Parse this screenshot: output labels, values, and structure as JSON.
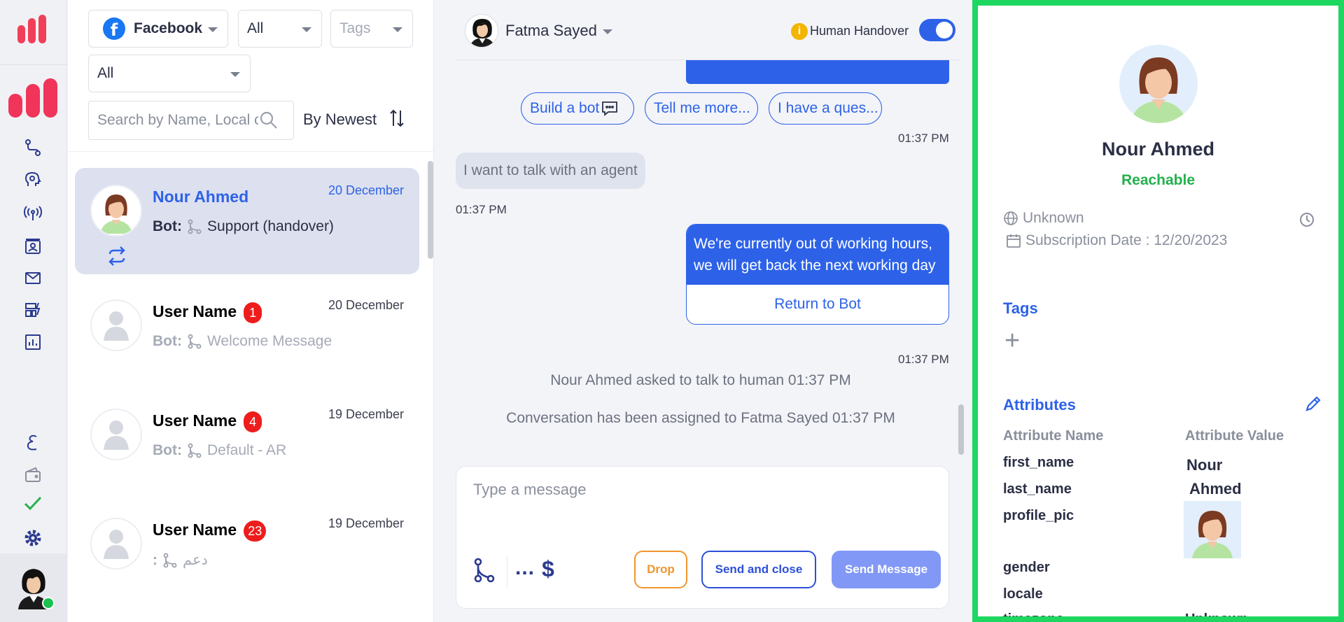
{
  "filters": {
    "channel": "Facebook",
    "channel_icon_letter": "f",
    "status": "All",
    "tags_placeholder": "Tags",
    "assignee": "All",
    "search_placeholder": "Search by Name, Local c",
    "sort_label": "By Newest"
  },
  "conversations": [
    {
      "name": "Nour Ahmed",
      "date": "20 December",
      "bot_label": "Bot:",
      "flow": "Support (handover)",
      "badge": ""
    },
    {
      "name": "User Name",
      "date": "20 December",
      "bot_label": "Bot:",
      "flow": "Welcome Message",
      "badge": "1"
    },
    {
      "name": "User Name",
      "date": "19 December",
      "bot_label": "Bot:",
      "flow": "Default - AR",
      "badge": "4"
    },
    {
      "name": "User Name",
      "date": "19 December",
      "bot_label": ":",
      "flow": "دعم",
      "badge": "23"
    }
  ],
  "chat": {
    "agent_name": "Fatma Sayed",
    "handover_label": "Human Handover",
    "handover_info_icon": "i",
    "quick_replies": [
      "Build a bot",
      "Tell me more...",
      "I have a ques..."
    ],
    "time1": "01:37 PM",
    "incoming": "I want to talk with an agent",
    "time2": "01:37 PM",
    "outgoing": "We're currently out of working hours, we will get back the next working day",
    "return_button": "Return to Bot",
    "time3": "01:37 PM",
    "system1": "Nour Ahmed asked to talk to human 01:37 PM",
    "system2": "Conversation has been assigned to Fatma Sayed 01:37 PM"
  },
  "composer": {
    "placeholder": "Type a message",
    "dots": "...",
    "dollar": "$",
    "drop": "Drop",
    "send_close": "Send and close",
    "send": "Send Message"
  },
  "contact": {
    "name": "Nour Ahmed",
    "status": "Reachable",
    "locale": "Unknown",
    "subscription": "Subscription Date : 12/20/2023",
    "tags_title": "Tags",
    "add_tag": "+",
    "attributes_title": "Attributes",
    "attr_name_header": "Attribute Name",
    "attr_value_header": "Attribute Value",
    "attributes": [
      {
        "key": "first_name",
        "value": "Nour"
      },
      {
        "key": "last_name",
        "value": "Ahmed"
      },
      {
        "key": "profile_pic",
        "value": ""
      },
      {
        "key": "gender",
        "value": ""
      },
      {
        "key": "locale",
        "value": ""
      },
      {
        "key": "timezone",
        "value": "Unknown"
      }
    ]
  },
  "colors": {
    "accent": "#2d62e8",
    "reachable": "#24b04d",
    "badge": "#ee1c1c",
    "drop": "#f0962d",
    "highlight_border": "#1ed760"
  }
}
